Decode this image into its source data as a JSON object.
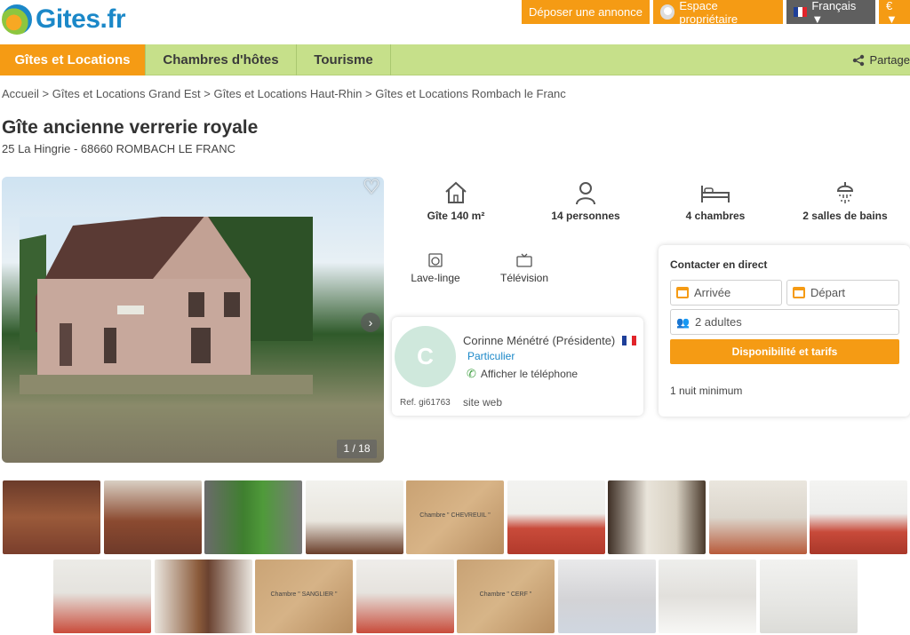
{
  "header": {
    "logo_text": "Gites.fr",
    "post_ad": "Déposer une annonce",
    "owner_space": "Espace propriétaire",
    "language": "Français ▼",
    "currency": "€ ▼"
  },
  "nav": {
    "items": [
      "Gîtes et Locations",
      "Chambres d'hôtes",
      "Tourisme"
    ],
    "share": "Partage"
  },
  "breadcrumb": "Accueil > Gîtes et Locations Grand Est > Gîtes et Locations Haut-Rhin > Gîtes et Locations Rombach le Franc",
  "listing": {
    "title": "Gîte ancienne verrerie royale",
    "address": "25 La Hingrie - 68660 ROMBACH LE FRANC",
    "photo_counter": "1 / 18"
  },
  "features": [
    {
      "icon": "house-icon",
      "label": "Gîte 140 m²"
    },
    {
      "icon": "person-icon",
      "label": "14 personnes"
    },
    {
      "icon": "bed-icon",
      "label": "4 chambres"
    },
    {
      "icon": "shower-icon",
      "label": "2 salles de bains"
    }
  ],
  "amenities": [
    {
      "icon": "washing-machine-icon",
      "label": "Lave-linge"
    },
    {
      "icon": "tv-icon",
      "label": "Télévision"
    }
  ],
  "owner": {
    "initial": "C",
    "name": "Corinne Ménétré (Présidente)",
    "type": "Particulier",
    "phone": "Afficher le téléphone",
    "ref": "Ref. gi61763",
    "site": "site web"
  },
  "contact": {
    "title": "Contacter en direct",
    "arrival": "Arrivée",
    "departure": "Départ",
    "guests": "2 adultes",
    "cta": "Disponibilité et tarifs",
    "min_nights": "1 nuit minimum"
  },
  "thumbnails_row1": [
    {
      "label": ""
    },
    {
      "label": ""
    },
    {
      "label": ""
    },
    {
      "label": ""
    },
    {
      "label": "Chambre \" CHEVREUIL \""
    },
    {
      "label": ""
    },
    {
      "label": ""
    },
    {
      "label": ""
    },
    {
      "label": ""
    }
  ],
  "thumbnails_row2": [
    {
      "label": ""
    },
    {
      "label": ""
    },
    {
      "label": "Chambre \" SANGLIER \""
    },
    {
      "label": ""
    },
    {
      "label": "Chambre \" CERF \""
    },
    {
      "label": ""
    },
    {
      "label": ""
    },
    {
      "label": ""
    }
  ],
  "colors": {
    "accent": "#f59b14",
    "nav_bg": "#c6e08a",
    "link": "#1b88c8"
  }
}
